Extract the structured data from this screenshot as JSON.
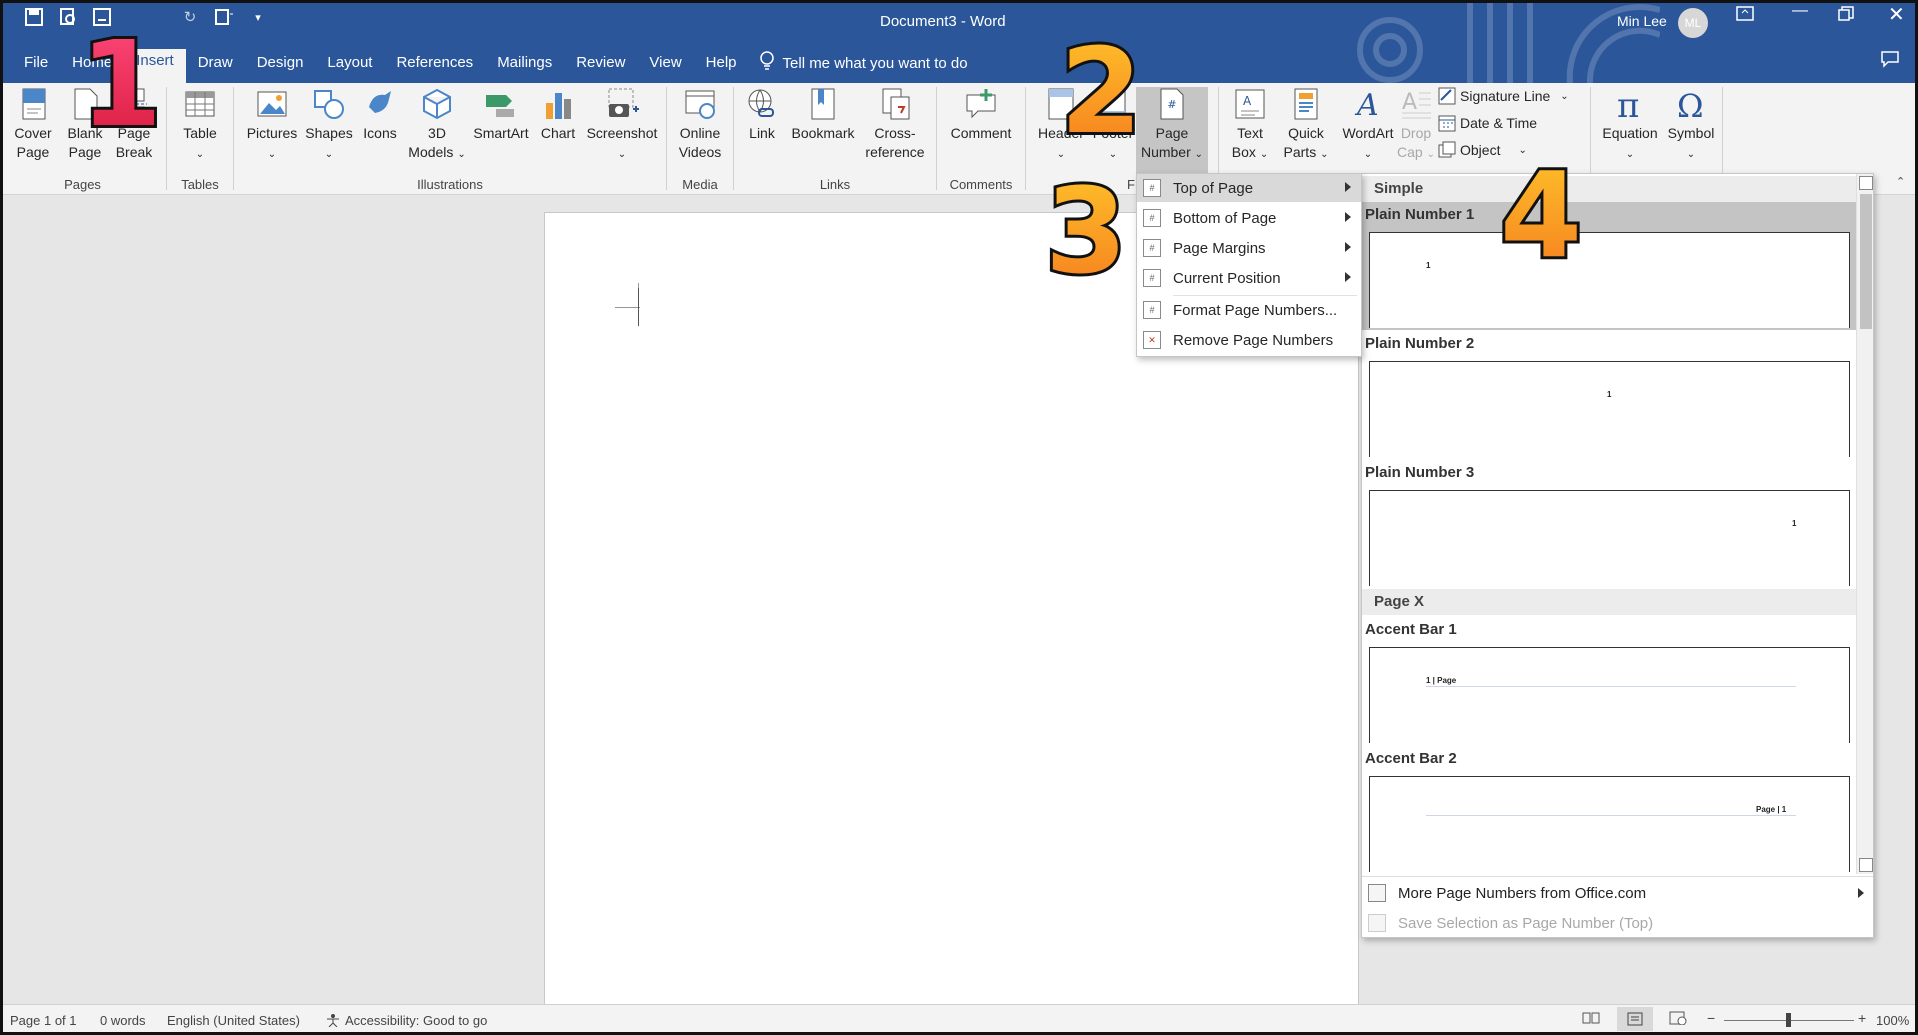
{
  "window": {
    "doc_title": "Document3  -  Word",
    "user_name": "Min Lee",
    "user_initials": "ML"
  },
  "tabs": [
    "File",
    "Home",
    "Insert",
    "Draw",
    "Design",
    "Layout",
    "References",
    "Mailings",
    "Review",
    "View",
    "Help"
  ],
  "tell_me": "Tell me what you want to do",
  "ribbon": {
    "pages": {
      "label": "Pages",
      "cover": "Cover\nPage",
      "blank": "Blank\nPage",
      "break": "Page\nBreak"
    },
    "tables": {
      "label": "Tables",
      "table": "Table"
    },
    "illustrations": {
      "label": "Illustrations",
      "pictures": "Pictures",
      "shapes": "Shapes",
      "icons": "Icons",
      "models": "3D\nModels",
      "smartart": "SmartArt",
      "chart": "Chart",
      "screenshot": "Screenshot"
    },
    "media": {
      "label": "Media",
      "videos": "Online\nVideos"
    },
    "links": {
      "label": "Links",
      "link": "Link",
      "bookmark": "Bookmark",
      "crossref": "Cross-\nreference"
    },
    "comments": {
      "label": "Comments",
      "comment": "Comment"
    },
    "hf": {
      "header": "Header",
      "footer": "Footer",
      "page_number": "Page\nNumber",
      "label_fragment": "F"
    },
    "text": {
      "textbox": "Text\nBox",
      "quickparts": "Quick\nParts",
      "wordart": "WordArt",
      "dropcap": "Drop\nCap",
      "signature": "Signature Line",
      "datetime": "Date & Time",
      "object": "Object"
    },
    "symbols": {
      "equation": "Equation",
      "symbol": "Symbol"
    }
  },
  "page_number_menu": {
    "items": [
      {
        "label": "Top of Page",
        "submenu": true,
        "highlighted": true
      },
      {
        "label": "Bottom of Page",
        "submenu": true
      },
      {
        "label": "Page Margins",
        "submenu": true
      },
      {
        "label": "Current Position",
        "submenu": true
      },
      {
        "label": "Format Page Numbers...",
        "submenu": false
      },
      {
        "label": "Remove Page Numbers",
        "submenu": false
      }
    ]
  },
  "gallery": {
    "cat_simple": "Simple",
    "cat_pagex": "Page X",
    "items": [
      "Plain Number 1",
      "Plain Number 2",
      "Plain Number 3",
      "Accent Bar 1",
      "Accent Bar 2"
    ],
    "thumb_num": "1",
    "accent1_text": "1 | Page",
    "accent2_text": "Page | 1",
    "more": "More Page Numbers from Office.com",
    "save": "Save Selection as Page Number (Top)"
  },
  "status": {
    "page": "Page 1 of 1",
    "words": "0 words",
    "language": "English (United States)",
    "accessibility": "Accessibility: Good to go",
    "zoom": "100%"
  },
  "annotations": [
    "1",
    "2",
    "3",
    "4"
  ],
  "colors": {
    "title_bar": "#2b579a",
    "ribbon": "#f3f3f3",
    "highlight": "#c5c5c5"
  }
}
